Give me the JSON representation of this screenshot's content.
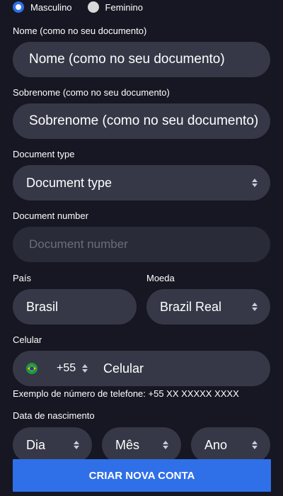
{
  "gender": {
    "options": [
      {
        "label": "Masculino",
        "selected": true
      },
      {
        "label": "Feminino",
        "selected": false
      }
    ]
  },
  "first_name": {
    "label": "Nome (como no seu documento)",
    "placeholder": "Nome (como no seu documento)"
  },
  "last_name": {
    "label": "Sobrenome (como no seu documento)",
    "placeholder": "Sobrenome (como no seu documento)"
  },
  "document_type": {
    "label": "Document type",
    "value": "Document type"
  },
  "document_number": {
    "label": "Document number",
    "placeholder": "Document number"
  },
  "country": {
    "label": "País",
    "value": "Brasil"
  },
  "currency": {
    "label": "Moeda",
    "value": "Brazil Real"
  },
  "phone": {
    "label": "Celular",
    "flag_icon": "brazil-flag-icon",
    "country_code": "+55",
    "placeholder": "Celular",
    "hint": "Exemplo de número de telefone: +55 XX XXXXX XXXX"
  },
  "birth_date": {
    "label": "Data de nascimento",
    "day": "Dia",
    "month": "Mês",
    "year": "Ano"
  },
  "submit": {
    "label": "CRIAR NOVA CONTA"
  },
  "colors": {
    "background": "#161722",
    "field": "#363847",
    "accent": "#2f6fe8"
  }
}
